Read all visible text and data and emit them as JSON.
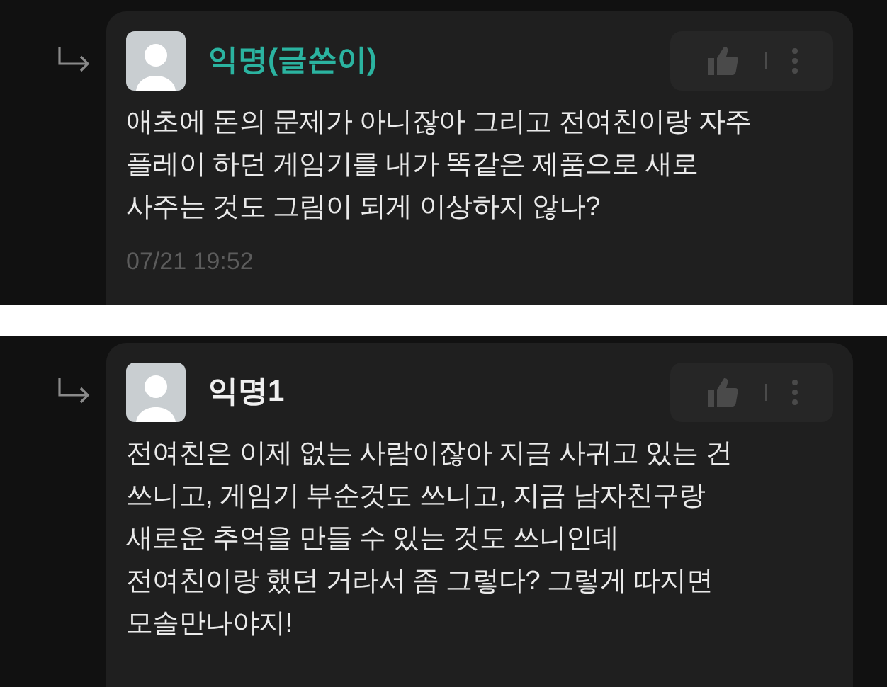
{
  "comments": [
    {
      "name": "익명(글쓴이)",
      "author": true,
      "body": "애초에 돈의 문제가 아니잖아 그리고 전여친이랑 자주\n플레이 하던 게임기를 내가 똑같은 제품으로 새로\n사주는 것도 그림이 되게 이상하지 않나?",
      "date": "07/21 19:52"
    },
    {
      "name": "익명1",
      "author": false,
      "body": "전여친은 이제 없는 사람이잖아 지금 사귀고 있는 건\n쓰니고, 게임기 부순것도 쓰니고, 지금 남자친구랑\n새로운 추억을 만들 수 있는 것도 쓰니인데\n전여친이랑 했던 거라서 좀 그렇다? 그렇게 따지면\n모솔만나야지!"
    }
  ]
}
